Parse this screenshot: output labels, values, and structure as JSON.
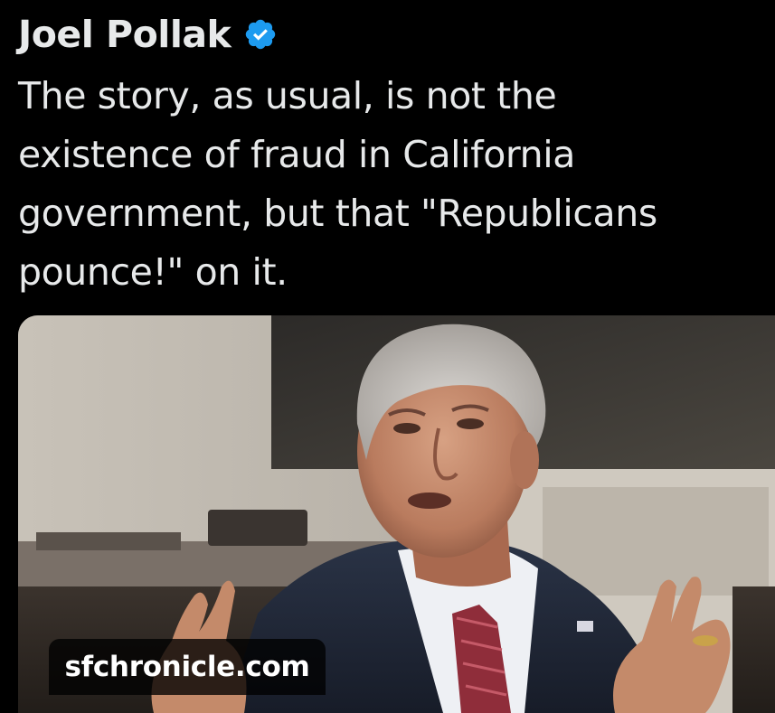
{
  "author": {
    "name": "Joel Pollak",
    "verified_icon": "verified-badge-icon",
    "verified_color": "#1d9bf0"
  },
  "tweet": {
    "lines": [
      "The story, as usual, is not the",
      "existence of fraud in California",
      "government, but that \"Republicans",
      "pounce!\" on it."
    ]
  },
  "media": {
    "domain_label": "sfchronicle.com"
  },
  "colors": {
    "background": "#000000",
    "text": "#e7e9ea",
    "accent": "#1d9bf0"
  }
}
